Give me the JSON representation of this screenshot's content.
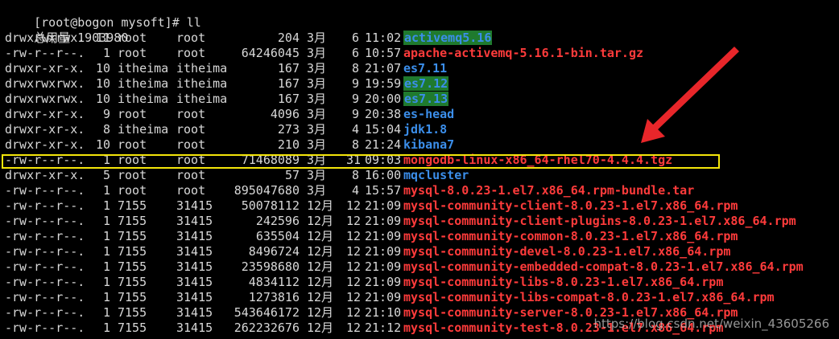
{
  "prompt": "[root@bogon mysoft]# ll",
  "total": "总用量 1903980",
  "rows": [
    {
      "perm": "drwxrwxrwx.",
      "links": "11",
      "owner": "root",
      "group": "root",
      "size": "204",
      "month": "3月",
      "day": "6",
      "time": "11:02",
      "name": "activemq5.16",
      "kind": "green"
    },
    {
      "perm": "-rw-r--r--.",
      "links": "1",
      "owner": "root",
      "group": "root",
      "size": "64246045",
      "month": "3月",
      "day": "6",
      "time": "10:57",
      "name": "apache-activemq-5.16.1-bin.tar.gz",
      "kind": "red"
    },
    {
      "perm": "drwxr-xr-x.",
      "links": "10",
      "owner": "itheima",
      "group": "itheima",
      "size": "167",
      "month": "3月",
      "day": "8",
      "time": "21:07",
      "name": "es7.11",
      "kind": "blue"
    },
    {
      "perm": "drwxrwxrwx.",
      "links": "10",
      "owner": "itheima",
      "group": "itheima",
      "size": "167",
      "month": "3月",
      "day": "9",
      "time": "19:59",
      "name": "es7.12",
      "kind": "green"
    },
    {
      "perm": "drwxrwxrwx.",
      "links": "10",
      "owner": "itheima",
      "group": "itheima",
      "size": "167",
      "month": "3月",
      "day": "9",
      "time": "20:00",
      "name": "es7.13",
      "kind": "green"
    },
    {
      "perm": "drwxr-xr-x.",
      "links": "9",
      "owner": "root",
      "group": "root",
      "size": "4096",
      "month": "3月",
      "day": "9",
      "time": "20:38",
      "name": "es-head",
      "kind": "blue"
    },
    {
      "perm": "drwxr-xr-x.",
      "links": "8",
      "owner": "itheima",
      "group": "root",
      "size": "273",
      "month": "3月",
      "day": "4",
      "time": "15:04",
      "name": "jdk1.8",
      "kind": "blue"
    },
    {
      "perm": "drwxr-xr-x.",
      "links": "10",
      "owner": "root",
      "group": "root",
      "size": "210",
      "month": "3月",
      "day": "8",
      "time": "21:24",
      "name": "kibana7",
      "kind": "blue"
    },
    {
      "perm": "-rw-r--r--.",
      "links": "1",
      "owner": "root",
      "group": "root",
      "size": "71468089",
      "month": "3月",
      "day": "31",
      "time": "09:03",
      "name": "mongodb-linux-x86_64-rhel70-4.4.4.tgz",
      "kind": "red"
    },
    {
      "perm": "drwxr-xr-x.",
      "links": "5",
      "owner": "root",
      "group": "root",
      "size": "57",
      "month": "3月",
      "day": "8",
      "time": "16:00",
      "name": "mqcluster",
      "kind": "blue"
    },
    {
      "perm": "-rw-r--r--.",
      "links": "1",
      "owner": "root",
      "group": "root",
      "size": "895047680",
      "month": "3月",
      "day": "4",
      "time": "15:57",
      "name": "mysql-8.0.23-1.el7.x86_64.rpm-bundle.tar",
      "kind": "red"
    },
    {
      "perm": "-rw-r--r--.",
      "links": "1",
      "owner": "7155",
      "group": "31415",
      "size": "50078112",
      "month": "12月",
      "day": "12",
      "time": "21:09",
      "name": "mysql-community-client-8.0.23-1.el7.x86_64.rpm",
      "kind": "red"
    },
    {
      "perm": "-rw-r--r--.",
      "links": "1",
      "owner": "7155",
      "group": "31415",
      "size": "242596",
      "month": "12月",
      "day": "12",
      "time": "21:09",
      "name": "mysql-community-client-plugins-8.0.23-1.el7.x86_64.rpm",
      "kind": "red"
    },
    {
      "perm": "-rw-r--r--.",
      "links": "1",
      "owner": "7155",
      "group": "31415",
      "size": "635504",
      "month": "12月",
      "day": "12",
      "time": "21:09",
      "name": "mysql-community-common-8.0.23-1.el7.x86_64.rpm",
      "kind": "red"
    },
    {
      "perm": "-rw-r--r--.",
      "links": "1",
      "owner": "7155",
      "group": "31415",
      "size": "8496724",
      "month": "12月",
      "day": "12",
      "time": "21:09",
      "name": "mysql-community-devel-8.0.23-1.el7.x86_64.rpm",
      "kind": "red"
    },
    {
      "perm": "-rw-r--r--.",
      "links": "1",
      "owner": "7155",
      "group": "31415",
      "size": "23598680",
      "month": "12月",
      "day": "12",
      "time": "21:09",
      "name": "mysql-community-embedded-compat-8.0.23-1.el7.x86_64.rpm",
      "kind": "red"
    },
    {
      "perm": "-rw-r--r--.",
      "links": "1",
      "owner": "7155",
      "group": "31415",
      "size": "4834112",
      "month": "12月",
      "day": "12",
      "time": "21:09",
      "name": "mysql-community-libs-8.0.23-1.el7.x86_64.rpm",
      "kind": "red"
    },
    {
      "perm": "-rw-r--r--.",
      "links": "1",
      "owner": "7155",
      "group": "31415",
      "size": "1273816",
      "month": "12月",
      "day": "12",
      "time": "21:09",
      "name": "mysql-community-libs-compat-8.0.23-1.el7.x86_64.rpm",
      "kind": "red"
    },
    {
      "perm": "-rw-r--r--.",
      "links": "1",
      "owner": "7155",
      "group": "31415",
      "size": "543646172",
      "month": "12月",
      "day": "12",
      "time": "21:10",
      "name": "mysql-community-server-8.0.23-1.el7.x86_64.rpm",
      "kind": "red"
    },
    {
      "perm": "-rw-r--r--.",
      "links": "1",
      "owner": "7155",
      "group": "31415",
      "size": "262232676",
      "month": "12月",
      "day": "12",
      "time": "21:12",
      "name": "mysql-community-test-8.0.23-1.el7.x86_64.rpm",
      "kind": "red"
    }
  ],
  "highlighted_row": "mongodb-linux-x86_64-rhel70-4.4.4.tgz",
  "watermark": "https://blog.csdn.net/weixin_43605266",
  "colors": {
    "background": "#000000",
    "text": "#d8d8d8",
    "file_red": "#ff3b3b",
    "dir_blue": "#3b8eea",
    "dir_green_bg": "#1f7a2e",
    "highlight_box": "#f5e60a",
    "arrow": "#e8262a"
  }
}
